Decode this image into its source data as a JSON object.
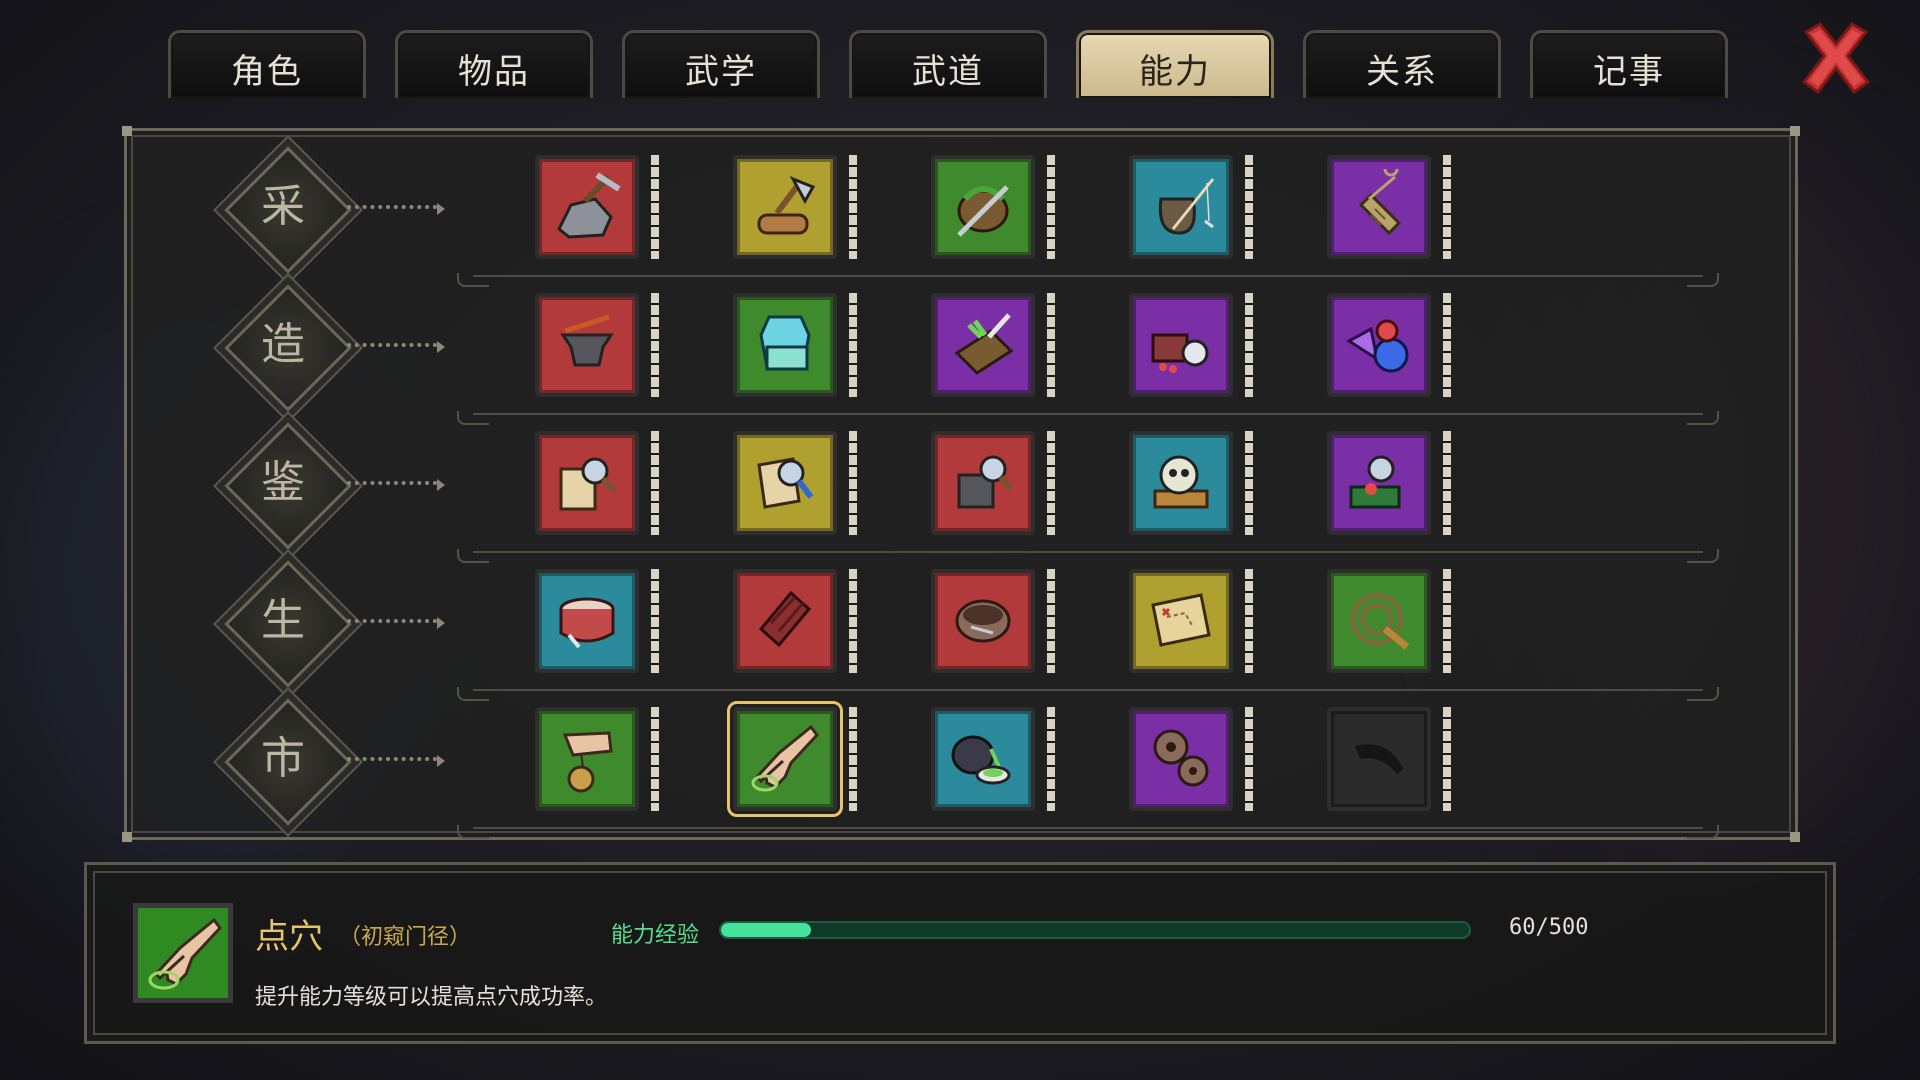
{
  "tabs": [
    {
      "label": "角色",
      "active": false
    },
    {
      "label": "物品",
      "active": false
    },
    {
      "label": "武学",
      "active": false
    },
    {
      "label": "武道",
      "active": false
    },
    {
      "label": "能力",
      "active": true
    },
    {
      "label": "关系",
      "active": false
    },
    {
      "label": "记事",
      "active": false
    }
  ],
  "close_icon": "close-x-icon",
  "categories": [
    {
      "label": "采",
      "skills": [
        {
          "icon": "mining-pickaxe-rock-icon",
          "frame": "#b33a3a"
        },
        {
          "icon": "woodcutting-axe-log-icon",
          "frame": "#b0a030"
        },
        {
          "icon": "herb-basket-sickle-icon",
          "frame": "#3f8a2c"
        },
        {
          "icon": "fishing-rod-jar-icon",
          "frame": "#2b8a9b"
        },
        {
          "icon": "net-catching-icon",
          "frame": "#7a2fa6"
        }
      ]
    },
    {
      "label": "造",
      "skills": [
        {
          "icon": "forging-anvil-icon",
          "frame": "#b33a3a"
        },
        {
          "icon": "tailoring-cloth-icon",
          "frame": "#3f8a2c"
        },
        {
          "icon": "herb-cutting-board-icon",
          "frame": "#7a2fa6"
        },
        {
          "icon": "alchemy-jewelry-box-icon",
          "frame": "#7a2fa6"
        },
        {
          "icon": "gem-crafting-icon",
          "frame": "#7a2fa6"
        }
      ]
    },
    {
      "label": "鉴",
      "skills": [
        {
          "icon": "scroll-appraise-icon",
          "frame": "#b33a3a"
        },
        {
          "icon": "book-appraise-icon",
          "frame": "#b0a030"
        },
        {
          "icon": "weapon-rack-appraise-icon",
          "frame": "#b33a3a"
        },
        {
          "icon": "skull-appraise-icon",
          "frame": "#2b8a9b"
        },
        {
          "icon": "gem-appraise-icon",
          "frame": "#7a2fa6"
        }
      ]
    },
    {
      "label": "生",
      "skills": [
        {
          "icon": "drum-icon",
          "frame": "#2b8a9b"
        },
        {
          "icon": "chocolate-bar-icon",
          "frame": "#b33a3a"
        },
        {
          "icon": "bowl-icon",
          "frame": "#b33a3a"
        },
        {
          "icon": "treasure-map-icon",
          "frame": "#b0a030"
        },
        {
          "icon": "whip-rope-icon",
          "frame": "#3f8a2c"
        }
      ]
    },
    {
      "label": "市",
      "skills": [
        {
          "icon": "hand-money-bag-icon",
          "frame": "#3f8a2c"
        },
        {
          "icon": "pointing-finger-icon",
          "frame": "#3f8a2c",
          "selected": true
        },
        {
          "icon": "teapot-cup-icon",
          "frame": "#2b8a9b"
        },
        {
          "icon": "gears-icon",
          "frame": "#7a2fa6"
        },
        {
          "icon": "horn-locked-icon",
          "frame": "#2a2a2a",
          "locked": true
        }
      ]
    }
  ],
  "selected": {
    "icon": "pointing-finger-icon",
    "name": "点穴",
    "rank": "（初窥门径）",
    "description": "提升能力等级可以提高点穴成功率。",
    "xp_label": "能力经验",
    "xp_current": 60,
    "xp_max": 500,
    "xp_text": "60/500"
  }
}
